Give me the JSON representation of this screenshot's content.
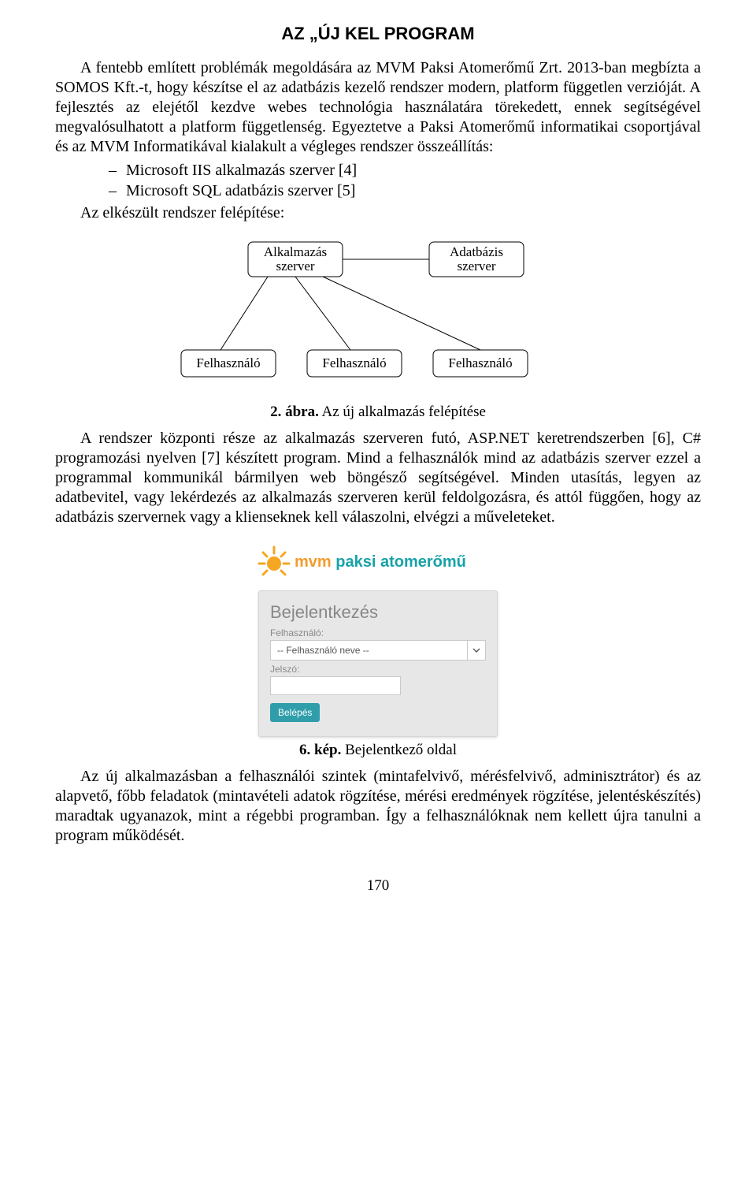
{
  "title": "AZ „ÚJ KEL PROGRAM",
  "para1": "A fentebb említett problémák megoldására az MVM Paksi Atomerőmű Zrt. 2013-ban megbízta a SOMOS Kft.-t, hogy készítse el az adatbázis kezelő rendszer modern, platform független verzióját. A fejlesztés az elejétől kezdve webes technológia használatára törekedett, ennek segítségével megvalósulhatott a platform függetlenség. Egyeztetve a Paksi Atomerőmű informatikai csoportjával és az MVM Informatikával kialakult a végleges rendszer összeállítás:",
  "bullets": [
    "Microsoft IIS alkalmazás szerver [4]",
    "Microsoft SQL adatbázis szerver [5]"
  ],
  "sub_intro": "Az elkészült rendszer felépítése:",
  "diagram": {
    "alkalmazas": "Alkalmazás szerver",
    "adatbazis": "Adatbázis szerver",
    "felhasznalo": "Felhasználó"
  },
  "caption1_num": "2. ábra.",
  "caption1_text": " Az új alkalmazás felépítése",
  "para2": "A rendszer központi része az alkalmazás szerveren futó, ASP.NET keretrendszerben [6], C# programozási nyelven [7] készített program. Mind a felhasználók mind az adatbázis szerver ezzel a programmal kommunikál bármilyen web böngésző segítségével. Minden utasítás, legyen az adatbevitel, vagy lekérdezés az alkalmazás szerveren kerül feldolgozásra, és attól függően, hogy az adatbázis szervernek vagy a klienseknek kell válaszolni, elvégzi a műveleteket.",
  "brand": {
    "t1": "mvm",
    "t2": " paksi atomerőmű"
  },
  "login": {
    "title": "Bejelentkezés",
    "user_label": "Felhasználó:",
    "user_placeholder": "-- Felhasználó neve --",
    "pw_label": "Jelszó:",
    "button": "Belépés"
  },
  "caption2_num": "6. kép.",
  "caption2_text": " Bejelentkező oldal",
  "para3": "Az új alkalmazásban a felhasználói szintek (mintafelvivő, mérésfelvivő, adminisztrátor) és az alapvető, főbb feladatok (mintavételi adatok rögzítése, mérési eredmények rögzítése, jelentéskészítés) maradtak ugyanazok, mint a régebbi programban. Így a felhasználóknak nem kellett újra tanulni a program működését.",
  "page_number": "170"
}
